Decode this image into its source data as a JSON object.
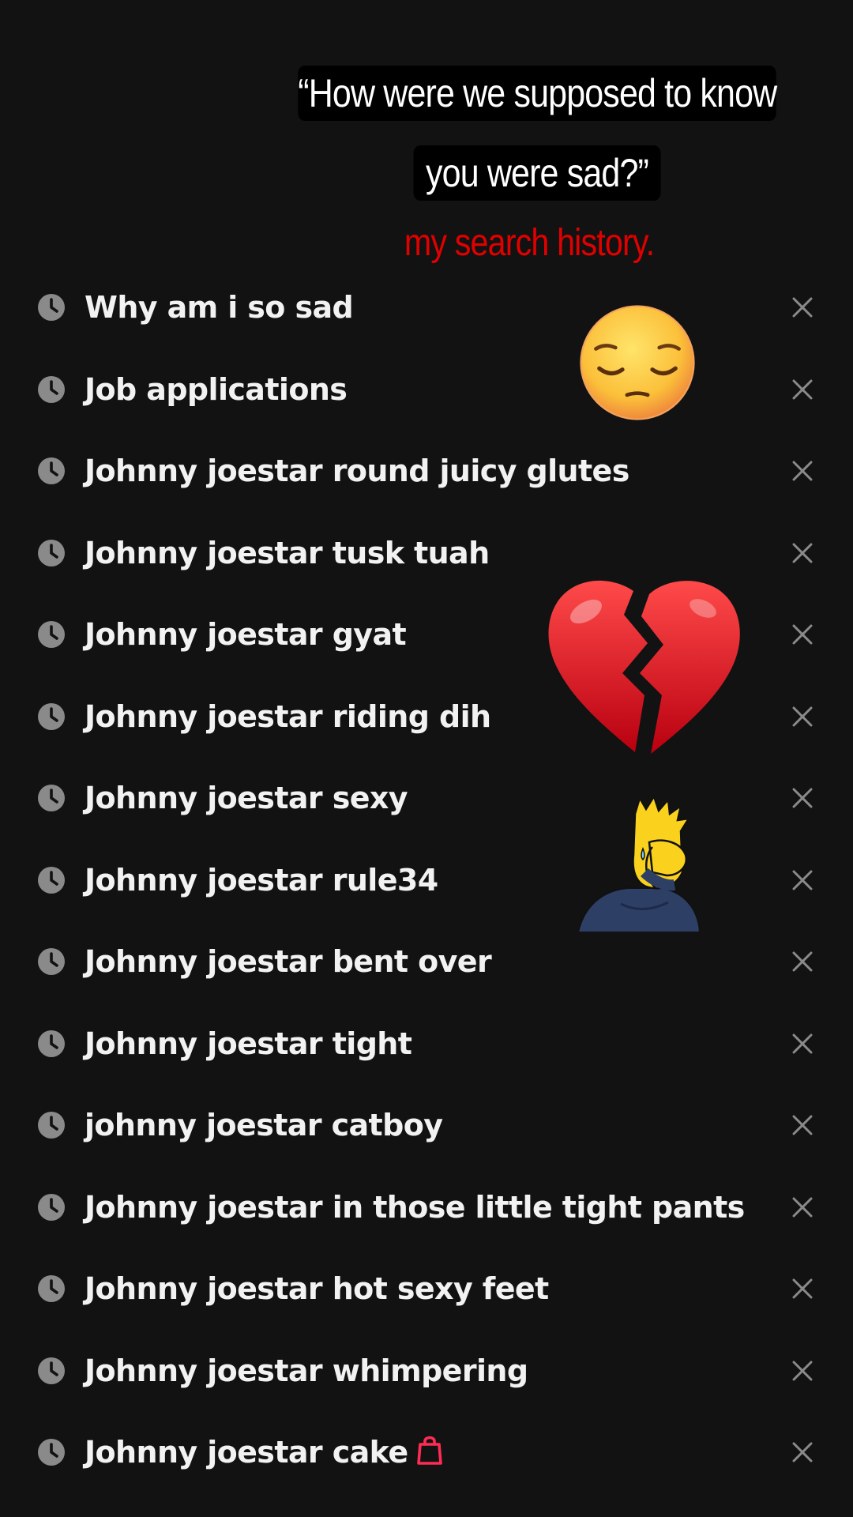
{
  "caption": {
    "line1": "“How were we supposed to know",
    "line2": "you were sad?”",
    "subtitle": "my search history.",
    "subtitle_color": "#e00000"
  },
  "history": {
    "items": [
      {
        "query": "Why am i so sad"
      },
      {
        "query": "Job applications"
      },
      {
        "query": "Johnny joestar round juicy glutes"
      },
      {
        "query": "Johnny joestar tusk tuah"
      },
      {
        "query": "Johnny joestar gyat"
      },
      {
        "query": "Johnny joestar riding dih"
      },
      {
        "query": "Johnny joestar sexy"
      },
      {
        "query": "Johnny joestar rule34"
      },
      {
        "query": "Johnny joestar bent over"
      },
      {
        "query": "Johnny joestar tight"
      },
      {
        "query": "johnny joestar catboy"
      },
      {
        "query": "Johnny joestar in those little tight pants"
      },
      {
        "query": "Johnny joestar hot sexy feet"
      },
      {
        "query": "Johnny joestar whimpering"
      },
      {
        "query": "Johnny joestar cake",
        "badge_icon": "shopping-bag-icon"
      }
    ],
    "row_icon": "clock-icon",
    "remove_icon": "close-icon"
  },
  "stickers": [
    {
      "name": "pensive-face-emoji"
    },
    {
      "name": "broken-heart-emoji"
    },
    {
      "name": "crying-cartoon-boy-sticker"
    }
  ],
  "colors": {
    "background": "#121212",
    "text": "#f2f2f2",
    "icon_gray": "#8a8a8a",
    "caption_bg": "#000000",
    "bag_icon": "#fe2c55"
  }
}
